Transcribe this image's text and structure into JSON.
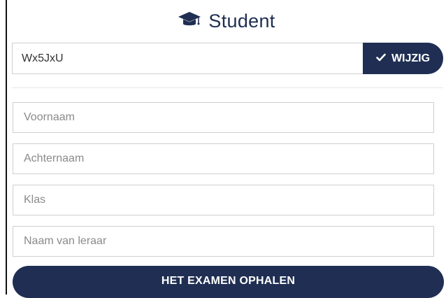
{
  "header": {
    "title": "Student",
    "icon": "graduation-cap-icon"
  },
  "code": {
    "value": "Wx5JxU",
    "button_label": "WIJZIG",
    "button_icon": "check-icon"
  },
  "fields": {
    "first_name_placeholder": "Voornaam",
    "last_name_placeholder": "Achternaam",
    "class_placeholder": "Klas",
    "teacher_placeholder": "Naam van leraar"
  },
  "submit": {
    "label": "HET EXAMEN OPHALEN"
  },
  "colors": {
    "primary": "#1f2e52",
    "border": "#cfcfcf",
    "placeholder": "#8a8a8a"
  }
}
